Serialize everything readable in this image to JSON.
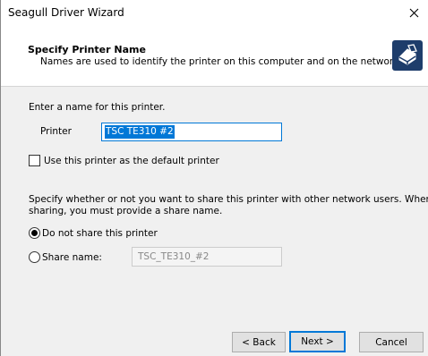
{
  "window": {
    "title": "Seagull Driver Wizard"
  },
  "header": {
    "title": "Specify Printer Name",
    "subtitle": "Names are used to identify the printer on this computer and on the network.",
    "icon": "printer-wizard-icon"
  },
  "form": {
    "name_prompt": "Enter a name for this printer.",
    "printer_label": "Printer",
    "printer_value": "TSC TE310 #2",
    "default_checkbox_label": "Use this printer as the default printer",
    "default_checked": false,
    "share_description_1": "Specify whether or not you want to share this printer with other network users.  When",
    "share_description_2": "sharing, you must provide a share name.",
    "no_share_label": "Do not share this printer",
    "share_label": "Share name:",
    "share_name_value": "TSC_TE310_#2",
    "selected_share_option": "no_share"
  },
  "buttons": {
    "back": "< Back",
    "next": "Next >",
    "cancel": "Cancel"
  }
}
